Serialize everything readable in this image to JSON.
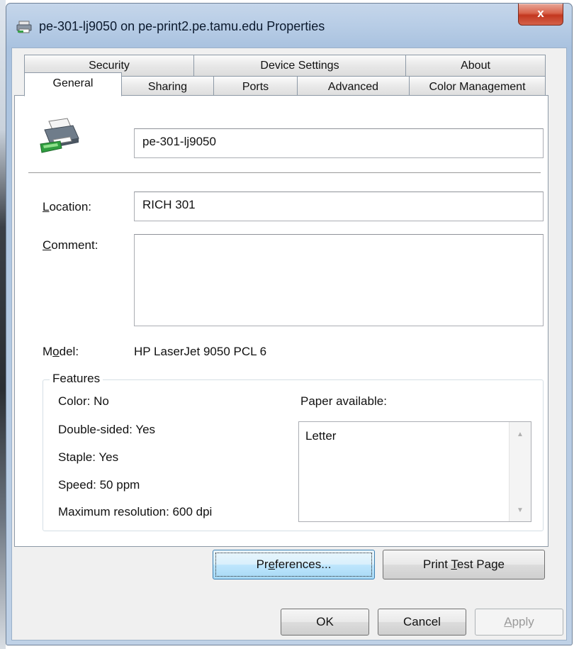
{
  "window": {
    "title": "pe-301-lj9050 on pe-print2.pe.tamu.edu Properties",
    "close_label": "x"
  },
  "tabs_back": [
    {
      "label": "Security"
    },
    {
      "label": "Device Settings"
    },
    {
      "label": "About"
    }
  ],
  "tabs_front": [
    {
      "label": "General",
      "selected": true
    },
    {
      "label": "Sharing"
    },
    {
      "label": "Ports"
    },
    {
      "label": "Advanced"
    },
    {
      "label": "Color Management"
    }
  ],
  "general": {
    "printer_name": "pe-301-lj9050",
    "location_label_pre": "",
    "location_label_key": "L",
    "location_label_post": "ocation:",
    "location_value": "RICH 301",
    "comment_label_key": "C",
    "comment_label_post": "omment:",
    "comment_value": "",
    "model_label_pre": "M",
    "model_label_key": "o",
    "model_label_post": "del:",
    "model_value": "HP LaserJet 9050 PCL 6"
  },
  "features": {
    "group_label": "Features",
    "color": "Color: No",
    "double_sided": "Double-sided: Yes",
    "staple": "Staple: Yes",
    "speed": "Speed: 50 ppm",
    "max_resolution": "Maximum resolution: 600 dpi",
    "paper_label": "Paper available:",
    "paper_items": [
      "Letter"
    ]
  },
  "buttons": {
    "preferences_pre": "Pr",
    "preferences_key": "e",
    "preferences_post": "ferences...",
    "print_test_pre": "Print ",
    "print_test_key": "T",
    "print_test_post": "est Page",
    "ok": "OK",
    "cancel": "Cancel",
    "apply_key": "A",
    "apply_post": "pply"
  }
}
